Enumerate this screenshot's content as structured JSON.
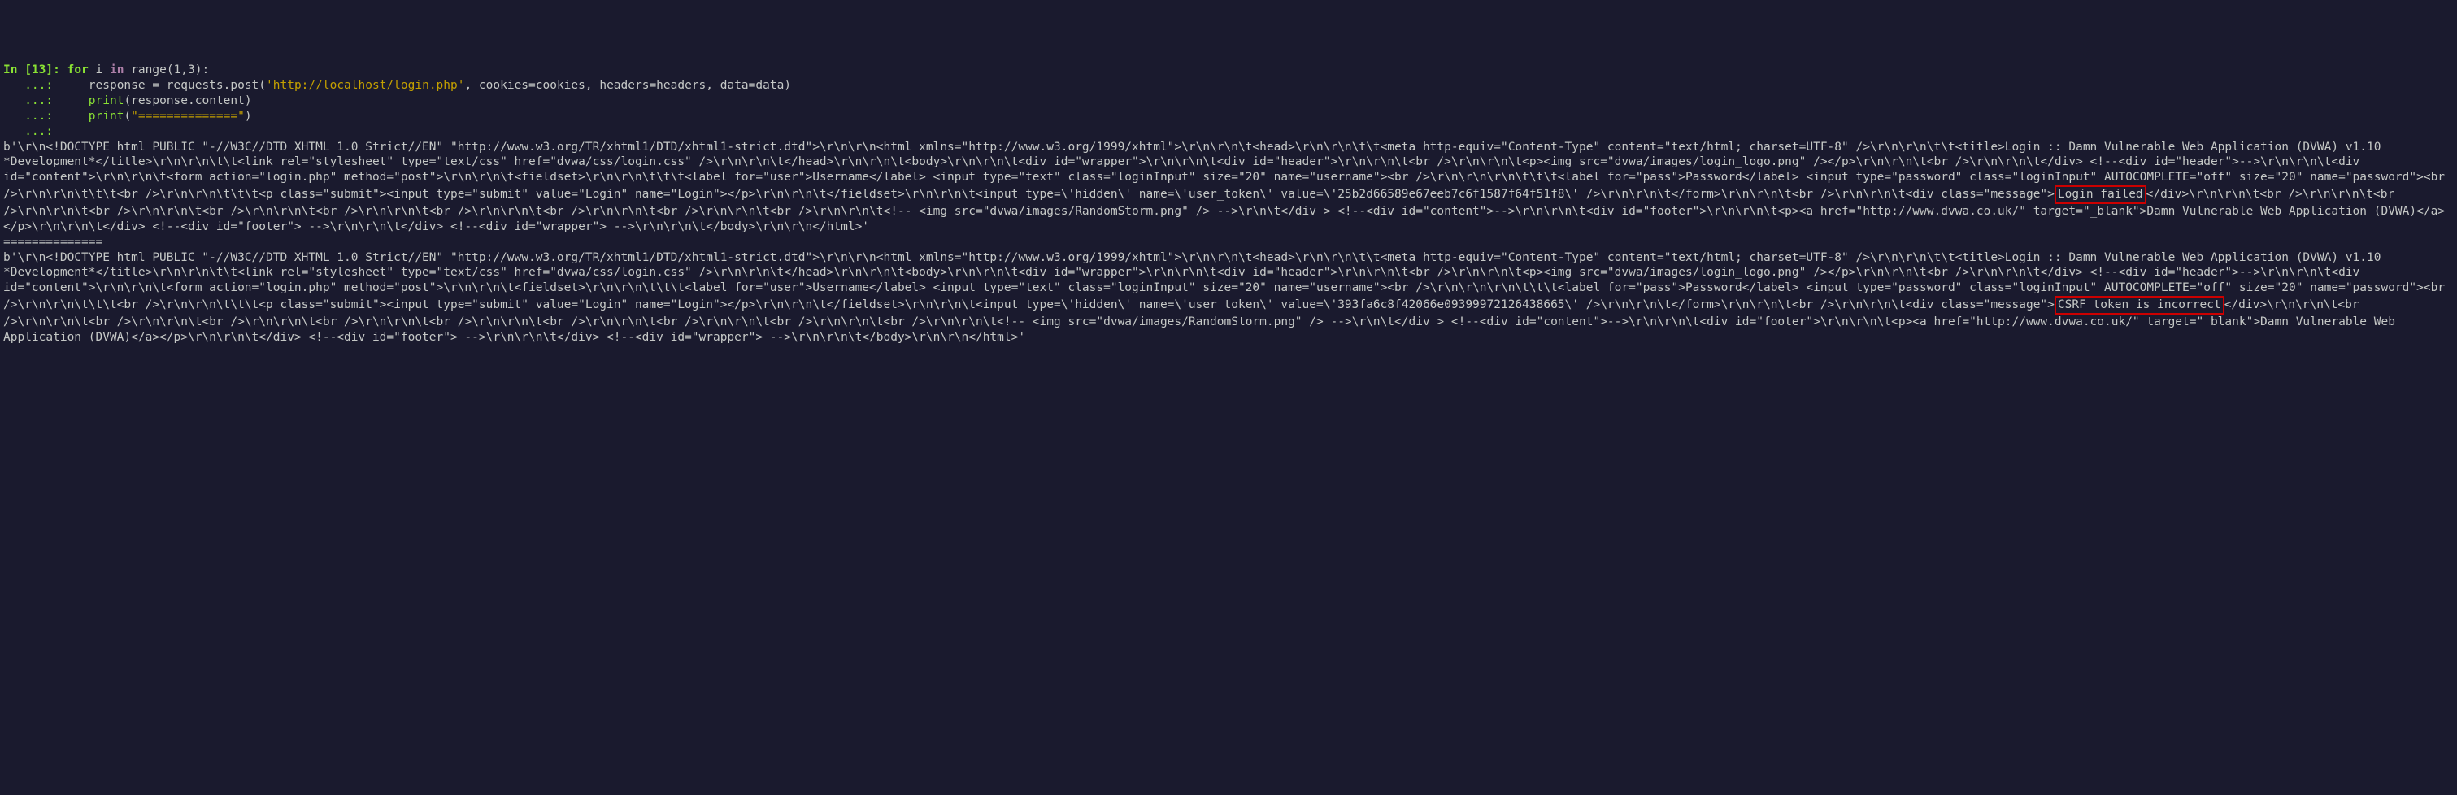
{
  "cell_number": "13",
  "code": {
    "line1_prefix": "In [",
    "line1_suffix": "]: ",
    "for_kw": "for",
    "var": " i ",
    "in_kw": "in",
    "range_call": " range(1,3):",
    "cont_prompt": "   ...: ",
    "line2": "    response = requests.post(",
    "url_string": "'http://localhost/login.php'",
    "line2_rest": ", cookies=cookies, headers=headers, data=data)",
    "line3a": "    ",
    "print_kw": "print",
    "line3b": "(response.content)",
    "line4a": "    ",
    "line4b": "(",
    "sep_string": "\"==============\"",
    "line4c": ")",
    "empty_cont": "   ...: "
  },
  "output1_pre": "b'\\r\\n<!DOCTYPE html PUBLIC \"-//W3C//DTD XHTML 1.0 Strict//EN\" \"http://www.w3.org/TR/xhtml1/DTD/xhtml1-strict.dtd\">\\r\\n\\r\\n<html xmlns=\"http://www.w3.org/1999/xhtml\">\\r\\n\\r\\n\\t<head>\\r\\n\\r\\n\\t\\t<meta http-equiv=\"Content-Type\" content=\"text/html; charset=UTF-8\" />\\r\\n\\r\\n\\t\\t<title>Login :: Damn Vulnerable Web Application (DVWA) v1.10 *Development*</title>\\r\\n\\r\\n\\t\\t<link rel=\"stylesheet\" type=\"text/css\" href=\"dvwa/css/login.css\" />\\r\\n\\r\\n\\t</head>\\r\\n\\r\\n\\t<body>\\r\\n\\r\\n\\t<div id=\"wrapper\">\\r\\n\\r\\n\\t<div id=\"header\">\\r\\n\\r\\n\\t<br />\\r\\n\\r\\n\\t<p><img src=\"dvwa/images/login_logo.png\" /></p>\\r\\n\\r\\n\\t<br />\\r\\n\\r\\n\\t</div> <!--<div id=\"header\">-->\\r\\n\\r\\n\\t<div id=\"content\">\\r\\n\\r\\n\\t<form action=\"login.php\" method=\"post\">\\r\\n\\r\\n\\t<fieldset>\\r\\n\\r\\n\\t\\t\\t<label for=\"user\">Username</label> <input type=\"text\" class=\"loginInput\" size=\"20\" name=\"username\"><br />\\r\\n\\r\\n\\r\\n\\t\\t\\t<label for=\"pass\">Password</label> <input type=\"password\" class=\"loginInput\" AUTOCOMPLETE=\"off\" size=\"20\" name=\"password\"><br />\\r\\n\\r\\n\\t\\t\\t<br />\\r\\n\\r\\n\\t\\t\\t<p class=\"submit\"><input type=\"submit\" value=\"Login\" name=\"Login\"></p>\\r\\n\\r\\n\\t</fieldset>\\r\\n\\r\\n\\t<input type=\\'hidden\\' name=\\'user_token\\' value=\\'25b2d66589e67eeb7c6f1587f64f51f8\\' />\\r\\n\\r\\n\\t</form>\\r\\n\\r\\n\\t<br />\\r\\n\\r\\n\\t<div class=\"message\">",
  "highlight1": "Login failed",
  "output1_post": "</div>\\r\\n\\r\\n\\t<br />\\r\\n\\r\\n\\t<br />\\r\\n\\r\\n\\t<br />\\r\\n\\r\\n\\t<br />\\r\\n\\r\\n\\t<br />\\r\\n\\r\\n\\t<br />\\r\\n\\r\\n\\t<br />\\r\\n\\r\\n\\t<br />\\r\\n\\r\\n\\t<br />\\r\\n\\r\\n\\t<!-- <img src=\"dvwa/images/RandomStorm.png\" /> -->\\r\\n\\t</div > <!--<div id=\"content\">-->\\r\\n\\r\\n\\t<div id=\"footer\">\\r\\n\\r\\n\\t<p><a href=\"http://www.dvwa.co.uk/\" target=\"_blank\">Damn Vulnerable Web Application (DVWA)</a></p>\\r\\n\\r\\n\\t</div> <!--<div id=\"footer\"> -->\\r\\n\\r\\n\\t</div> <!--<div id=\"wrapper\"> -->\\r\\n\\r\\n\\t</body>\\r\\n\\r\\n</html>'",
  "separator": "==============",
  "output2_pre": "b'\\r\\n<!DOCTYPE html PUBLIC \"-//W3C//DTD XHTML 1.0 Strict//EN\" \"http://www.w3.org/TR/xhtml1/DTD/xhtml1-strict.dtd\">\\r\\n\\r\\n<html xmlns=\"http://www.w3.org/1999/xhtml\">\\r\\n\\r\\n\\t<head>\\r\\n\\r\\n\\t\\t<meta http-equiv=\"Content-Type\" content=\"text/html; charset=UTF-8\" />\\r\\n\\r\\n\\t\\t<title>Login :: Damn Vulnerable Web Application (DVWA) v1.10 *Development*</title>\\r\\n\\r\\n\\t\\t<link rel=\"stylesheet\" type=\"text/css\" href=\"dvwa/css/login.css\" />\\r\\n\\r\\n\\t</head>\\r\\n\\r\\n\\t<body>\\r\\n\\r\\n\\t<div id=\"wrapper\">\\r\\n\\r\\n\\t<div id=\"header\">\\r\\n\\r\\n\\t<br />\\r\\n\\r\\n\\t<p><img src=\"dvwa/images/login_logo.png\" /></p>\\r\\n\\r\\n\\t<br />\\r\\n\\r\\n\\t</div> <!--<div id=\"header\">-->\\r\\n\\r\\n\\t<div id=\"content\">\\r\\n\\r\\n\\t<form action=\"login.php\" method=\"post\">\\r\\n\\r\\n\\t<fieldset>\\r\\n\\r\\n\\t\\t\\t<label for=\"user\">Username</label> <input type=\"text\" class=\"loginInput\" size=\"20\" name=\"username\"><br />\\r\\n\\r\\n\\r\\n\\t\\t\\t<label for=\"pass\">Password</label> <input type=\"password\" class=\"loginInput\" AUTOCOMPLETE=\"off\" size=\"20\" name=\"password\"><br />\\r\\n\\r\\n\\t\\t\\t<br />\\r\\n\\r\\n\\t\\t\\t<p class=\"submit\"><input type=\"submit\" value=\"Login\" name=\"Login\"></p>\\r\\n\\r\\n\\t</fieldset>\\r\\n\\r\\n\\t<input type=\\'hidden\\' name=\\'user_token\\' value=\\'393fa6c8f42066e09399972126438665\\' />\\r\\n\\r\\n\\t</form>\\r\\n\\r\\n\\t<br />\\r\\n\\r\\n\\t<div class=\"message\">",
  "highlight2": "CSRF token is incorrect",
  "output2_post": "</div>\\r\\n\\r\\n\\t<br />\\r\\n\\r\\n\\t<br />\\r\\n\\r\\n\\t<br />\\r\\n\\r\\n\\t<br />\\r\\n\\r\\n\\t<br />\\r\\n\\r\\n\\t<br />\\r\\n\\r\\n\\t<br />\\r\\n\\r\\n\\t<br />\\r\\n\\r\\n\\t<br />\\r\\n\\r\\n\\t<!-- <img src=\"dvwa/images/RandomStorm.png\" /> -->\\r\\n\\t</div > <!--<div id=\"content\">-->\\r\\n\\r\\n\\t<div id=\"footer\">\\r\\n\\r\\n\\t<p><a href=\"http://www.dvwa.co.uk/\" target=\"_blank\">Damn Vulnerable Web Application (DVWA)</a></p>\\r\\n\\r\\n\\t</div> <!--<div id=\"footer\"> -->\\r\\n\\r\\n\\t</div> <!--<div id=\"wrapper\"> -->\\r\\n\\r\\n\\t</body>\\r\\n\\r\\n</html>'"
}
